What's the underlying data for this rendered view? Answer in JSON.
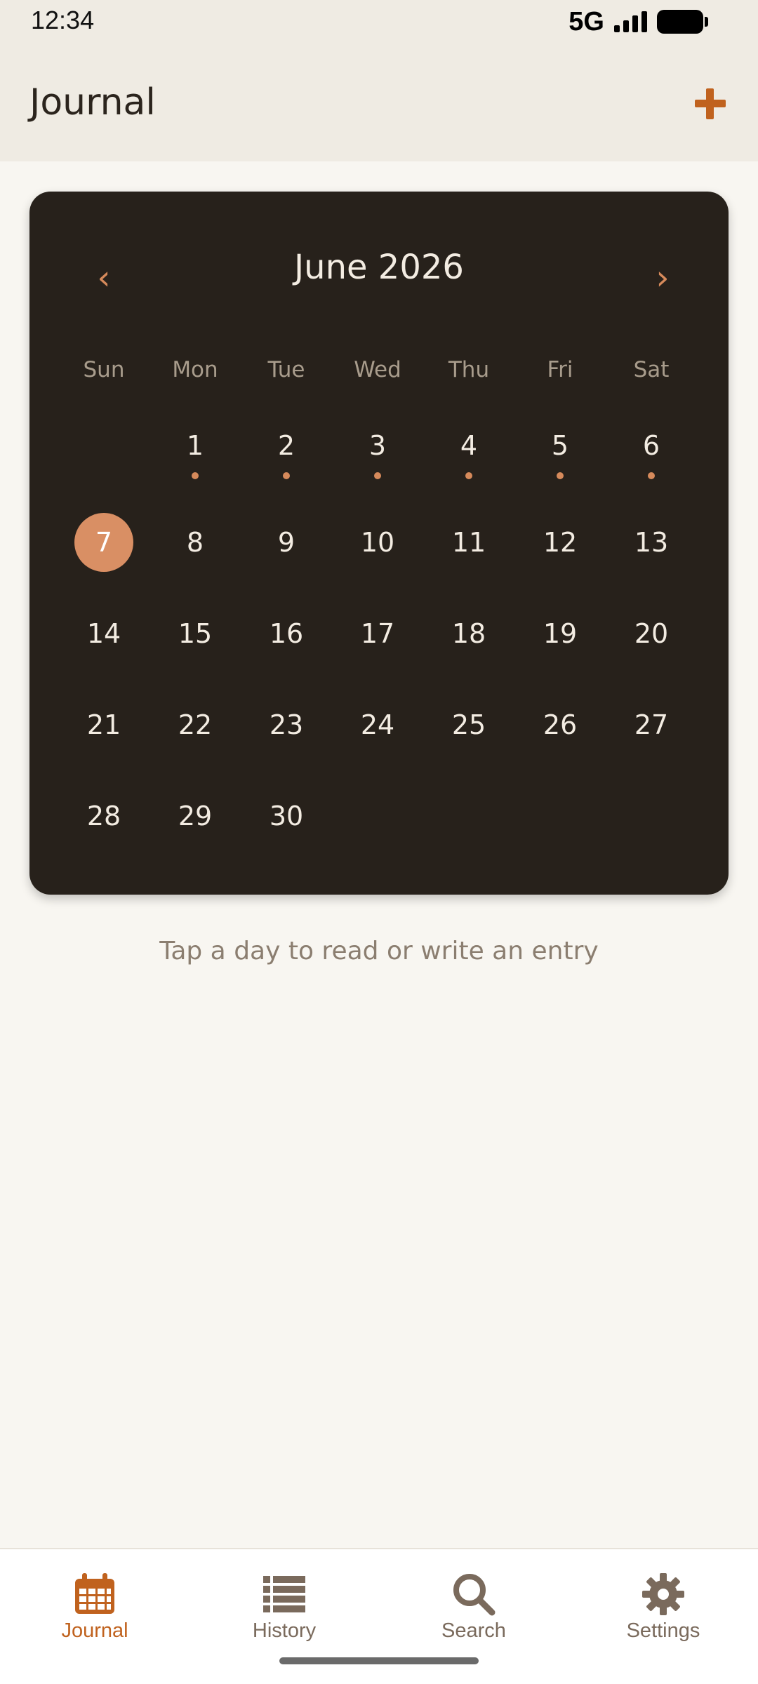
{
  "status_bar": {
    "time": "12:34",
    "network": "5G"
  },
  "app_bar": {
    "title": "Journal"
  },
  "calendar": {
    "month_title": "June 2026",
    "prev_glyph": "‹",
    "next_glyph": "›",
    "weekdays": [
      "Sun",
      "Mon",
      "Tue",
      "Wed",
      "Thu",
      "Fri",
      "Sat"
    ],
    "first_weekday_index": 1,
    "days_in_month": 30,
    "selected_day": 7,
    "days_with_entries": [
      1,
      2,
      3,
      4,
      5,
      6
    ]
  },
  "hint": "Tap a day to read or write an entry",
  "bottom_nav": {
    "items": [
      {
        "label": "Journal",
        "icon": "calendar-icon",
        "active": true
      },
      {
        "label": "History",
        "icon": "list-icon",
        "active": false
      },
      {
        "label": "Search",
        "icon": "search-icon",
        "active": false
      },
      {
        "label": "Settings",
        "icon": "gear-icon",
        "active": false
      }
    ]
  },
  "colors": {
    "accent": "#c0621e",
    "card_bg": "#27211b",
    "selected_day": "#d98f64",
    "entry_dot": "#d68a5b",
    "inactive_nav": "#7a6a5c"
  }
}
